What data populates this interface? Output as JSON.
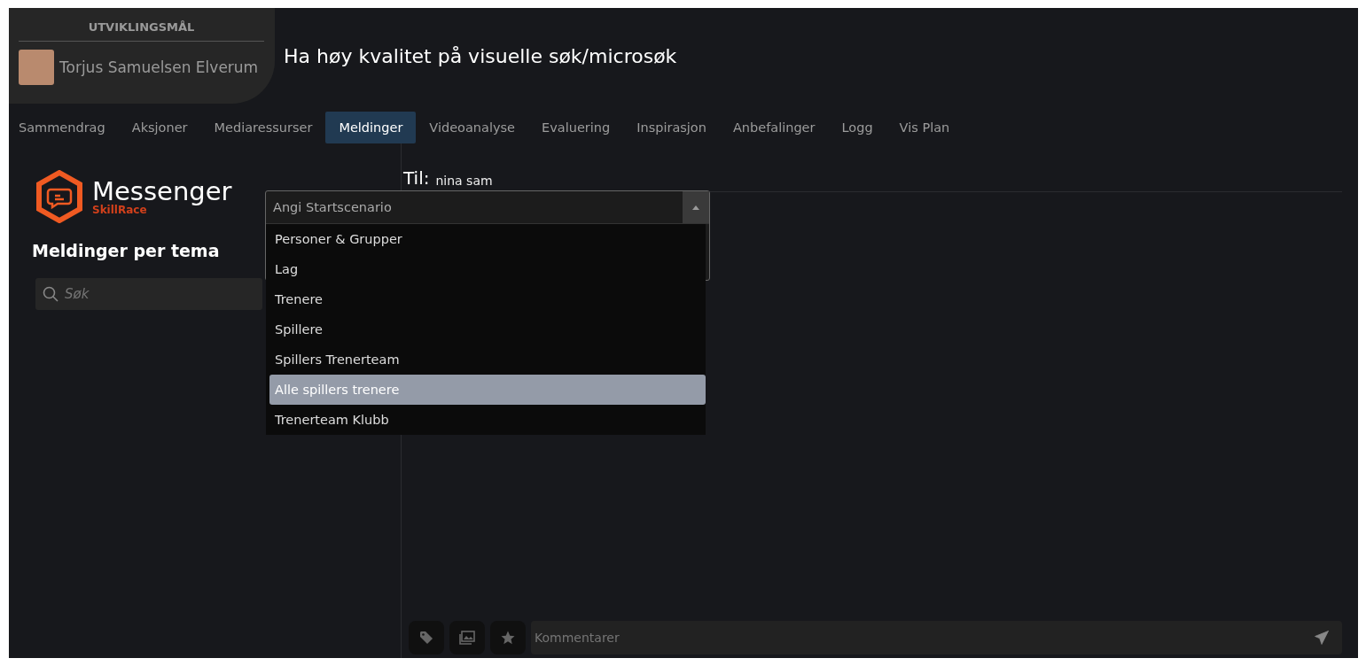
{
  "profile": {
    "section_label": "UTVIKLINGSMÅL",
    "name": "Torjus Samuelsen Elverum"
  },
  "title": "Ha høy kvalitet på visuelle søk/microsøk",
  "tabs": [
    {
      "label": "Sammendrag",
      "selected": false
    },
    {
      "label": "Aksjoner",
      "selected": false
    },
    {
      "label": "Mediaressurser",
      "selected": false
    },
    {
      "label": "Meldinger",
      "selected": true
    },
    {
      "label": "Videoanalyse",
      "selected": false
    },
    {
      "label": "Evaluering",
      "selected": false
    },
    {
      "label": "Inspirasjon",
      "selected": false
    },
    {
      "label": "Anbefalinger",
      "selected": false
    },
    {
      "label": "Logg",
      "selected": false
    },
    {
      "label": "Vis Plan",
      "selected": false
    }
  ],
  "sidebar": {
    "logo_title": "Messenger",
    "logo_subtitle": "SkillRace",
    "heading": "Meldinger per tema",
    "search": {
      "placeholder": "Søk"
    }
  },
  "recipient": {
    "label": "Til:",
    "value": "nina sam"
  },
  "scenario_select": {
    "placeholder": "Angi Startscenario",
    "expanded": true,
    "options": [
      {
        "label": "Personer & Grupper",
        "selected": false
      },
      {
        "label": "Lag",
        "selected": false
      },
      {
        "label": "Trenere",
        "selected": false
      },
      {
        "label": "Spillere",
        "selected": false
      },
      {
        "label": "Spillers Trenerteam",
        "selected": false
      },
      {
        "label": "Alle spillers trenere",
        "selected": true
      },
      {
        "label": "Trenerteam Klubb",
        "selected": false
      }
    ]
  },
  "composer": {
    "placeholder": "Kommentarer"
  }
}
